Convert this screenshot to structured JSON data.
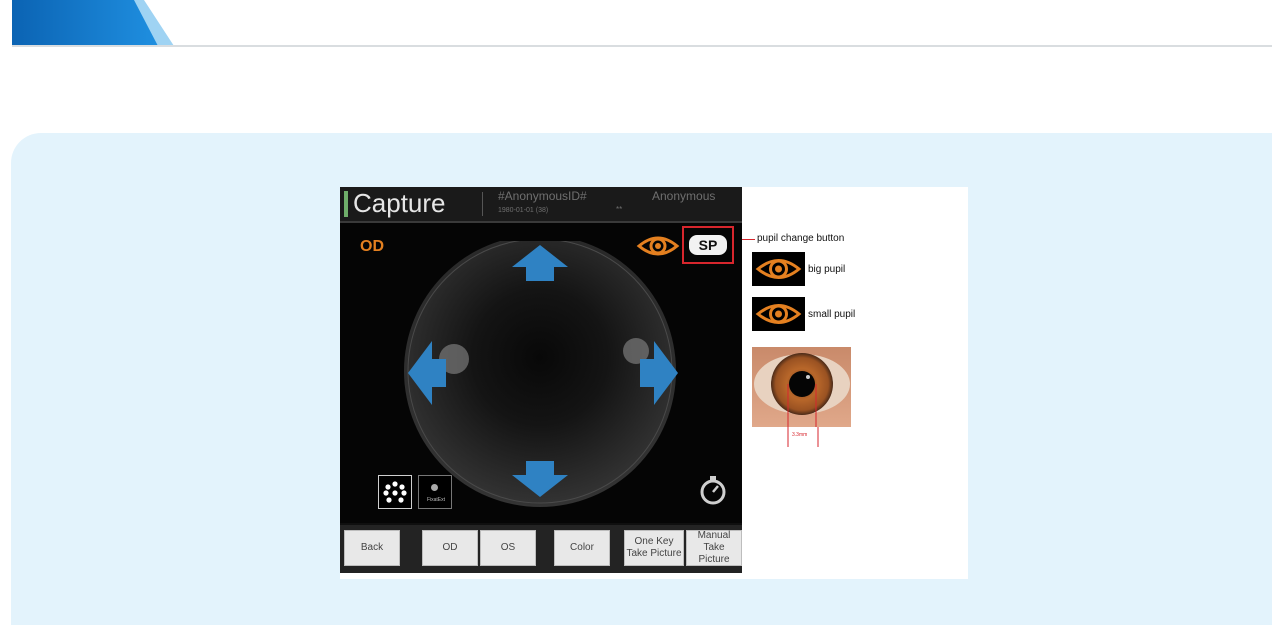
{
  "capture": {
    "title": "Capture",
    "patient_id": "#AnonymousID#",
    "patient_dob": "1980-01-01 (38)",
    "patient_sex": "**",
    "patient_name": "Anonymous",
    "eye_label": "OD",
    "sp_button": "SP",
    "fixation_button_label": "FixatExt"
  },
  "toolbar": {
    "buttons": [
      {
        "label": "Back"
      },
      {
        "label": "OD"
      },
      {
        "label": "OS"
      },
      {
        "label": "Color"
      },
      {
        "label": "One Key Take Picture"
      },
      {
        "label": "Manual Take Picture"
      }
    ]
  },
  "annotations": {
    "pupil_change": "pupil change button",
    "big_pupil": "big pupil",
    "small_pupil": "small pupil",
    "measurement": "3.3mm"
  },
  "colors": {
    "accent_orange": "#e48020",
    "callout_red": "#d7262d",
    "arrow_blue": "#2f82c3",
    "panel_bg": "#e3f3fc"
  },
  "icons": [
    "eye-icon",
    "timer-icon",
    "arrow-up-icon",
    "arrow-down-icon",
    "arrow-left-icon",
    "arrow-right-icon",
    "dot-grid-icon"
  ]
}
